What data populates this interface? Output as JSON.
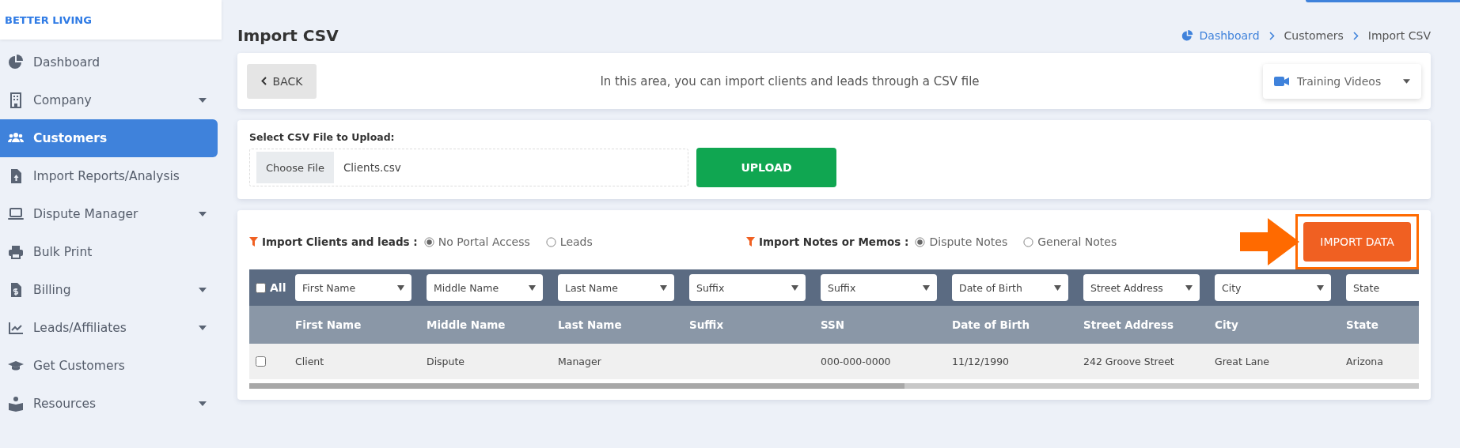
{
  "brand": "BETTER LIVING",
  "sidebar": {
    "items": [
      {
        "label": "Dashboard",
        "selected": false,
        "expandable": false
      },
      {
        "label": "Company",
        "selected": false,
        "expandable": true
      },
      {
        "label": "Customers",
        "selected": true,
        "expandable": false
      },
      {
        "label": "Import Reports/Analysis",
        "selected": false,
        "expandable": false
      },
      {
        "label": "Dispute Manager",
        "selected": false,
        "expandable": true
      },
      {
        "label": "Bulk Print",
        "selected": false,
        "expandable": false
      },
      {
        "label": "Billing",
        "selected": false,
        "expandable": true
      },
      {
        "label": "Leads/Affiliates",
        "selected": false,
        "expandable": true
      },
      {
        "label": "Get Customers",
        "selected": false,
        "expandable": false
      },
      {
        "label": "Resources",
        "selected": false,
        "expandable": true
      }
    ]
  },
  "page_title": "Import CSV",
  "breadcrumb": [
    {
      "label": "Dashboard",
      "link": true
    },
    {
      "label": "Customers",
      "link": false
    },
    {
      "label": "Import CSV",
      "link": false
    }
  ],
  "back_button": "BACK",
  "info_text": "In this area, you can import clients and leads through a CSV file",
  "training_dropdown": "Training Videos",
  "upload": {
    "label": "Select CSV File to Upload:",
    "choose_button": "Choose File",
    "file_name": "Clients.csv",
    "upload_button": "UPLOAD"
  },
  "import_groups": [
    {
      "label": "Import Clients and leads :",
      "options": [
        {
          "label": "No Portal Access",
          "selected": true
        },
        {
          "label": "Leads",
          "selected": false
        }
      ]
    },
    {
      "label": "Import Notes or Memos :",
      "options": [
        {
          "label": "Dispute Notes",
          "selected": true
        },
        {
          "label": "General Notes",
          "selected": false
        }
      ]
    }
  ],
  "import_button": "IMPORT DATA",
  "table": {
    "select_all": {
      "label": "All",
      "checked": false
    },
    "mapping_selects": [
      "First Name",
      "Middle Name",
      "Last Name",
      "Suffix",
      "Suffix",
      "Date of Birth",
      "Street Address",
      "City",
      "State"
    ],
    "columns": [
      "First Name",
      "Middle Name",
      "Last Name",
      "Suffix",
      "SSN",
      "Date of Birth",
      "Street Address",
      "City",
      "State"
    ],
    "rows": [
      {
        "checked": false,
        "cells": [
          "Client",
          "Dispute",
          "Manager",
          "",
          "000-000-0000",
          "11/12/1990",
          "242 Groove Street",
          "Great Lane",
          "Arizona"
        ]
      }
    ]
  }
}
